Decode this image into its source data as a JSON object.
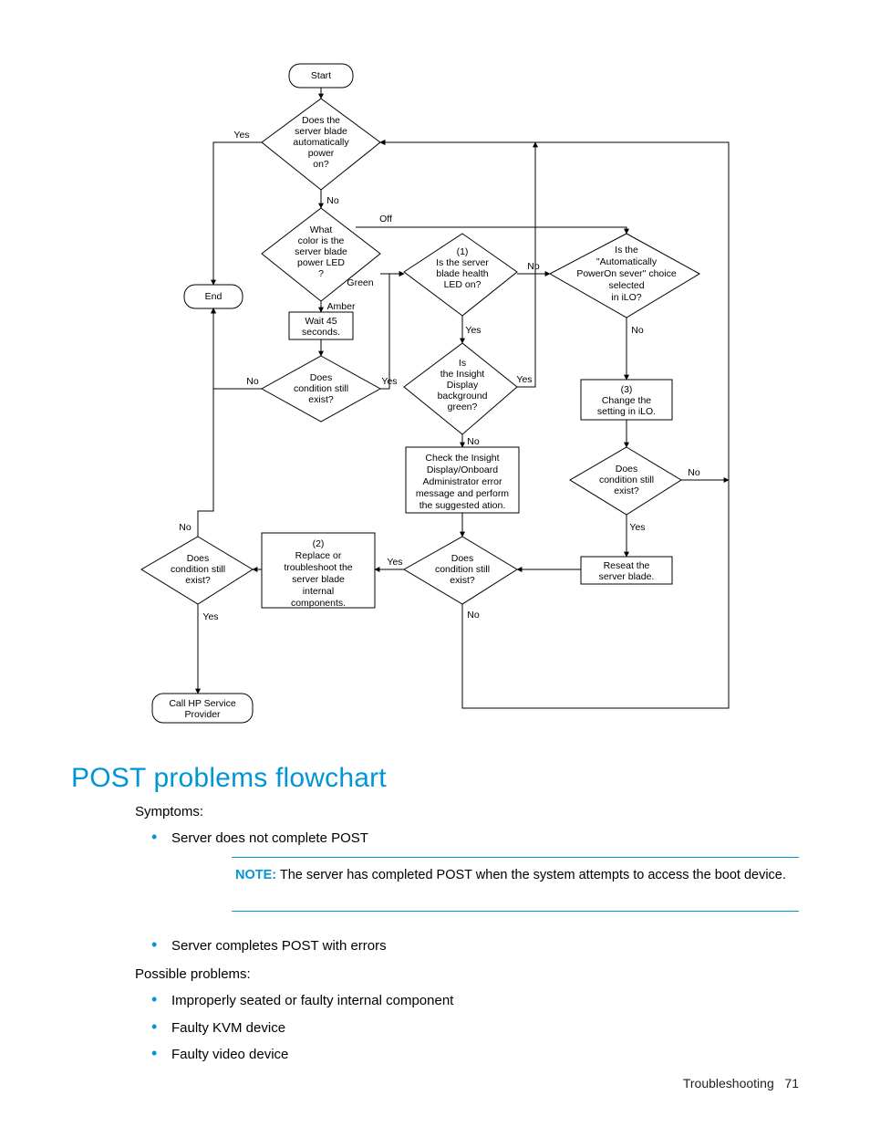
{
  "flowchart": {
    "nodes": {
      "start": "Start",
      "autoPower": [
        "Does the",
        "server blade",
        "automatically",
        "power",
        "on?"
      ],
      "ledColor": [
        "What",
        "color is the",
        "server blade",
        "power LED",
        "?"
      ],
      "end": "End",
      "wait45": [
        "Wait 45",
        "seconds."
      ],
      "condExist1": [
        "Does",
        "condition still",
        "exist?"
      ],
      "healthLed": [
        "(1)",
        "Is the server",
        "blade health",
        "LED on?"
      ],
      "insightGreen": [
        "Is",
        "the Insight",
        "Display",
        "background",
        "green?"
      ],
      "checkInsight": [
        "Check the Insight",
        "Display/Onboard",
        "Administrator error",
        "message and perform",
        "the suggested ation."
      ],
      "condExist2": [
        "Does",
        "condition still",
        "exist?"
      ],
      "replace": [
        "(2)",
        "Replace or",
        "troubleshoot the",
        "server blade",
        "internal",
        "components."
      ],
      "condExist3": [
        "Does",
        "condition still",
        "exist?"
      ],
      "callHp": [
        "Call HP Service",
        "Provider"
      ],
      "iloChoice": [
        "Is the",
        "\"Automatically",
        "PowerOn sever\" choice",
        "selected",
        "in iLO?"
      ],
      "changeSetting": [
        "(3)",
        "Change the",
        "setting in iLO."
      ],
      "condExist4": [
        "Does",
        "condition still",
        "exist?"
      ],
      "reseat": [
        "Reseat the",
        "server blade."
      ]
    },
    "edges": {
      "yes": "Yes",
      "no": "No",
      "off": "Off",
      "green": "Green",
      "amber": "Amber"
    }
  },
  "section": {
    "title": "POST problems flowchart",
    "symptomsLabel": "Symptoms:",
    "symptom1": "Server does not complete POST",
    "noteLabel": "NOTE:",
    "noteText": "  The server has completed POST when the system attempts to access the boot device.",
    "symptom2": "Server completes POST with errors",
    "possibleLabel": "Possible problems:",
    "pp1": "Improperly seated or faulty internal component",
    "pp2": "Faulty KVM device",
    "pp3": "Faulty video device"
  },
  "footer": {
    "section": "Troubleshooting",
    "page": "71"
  }
}
